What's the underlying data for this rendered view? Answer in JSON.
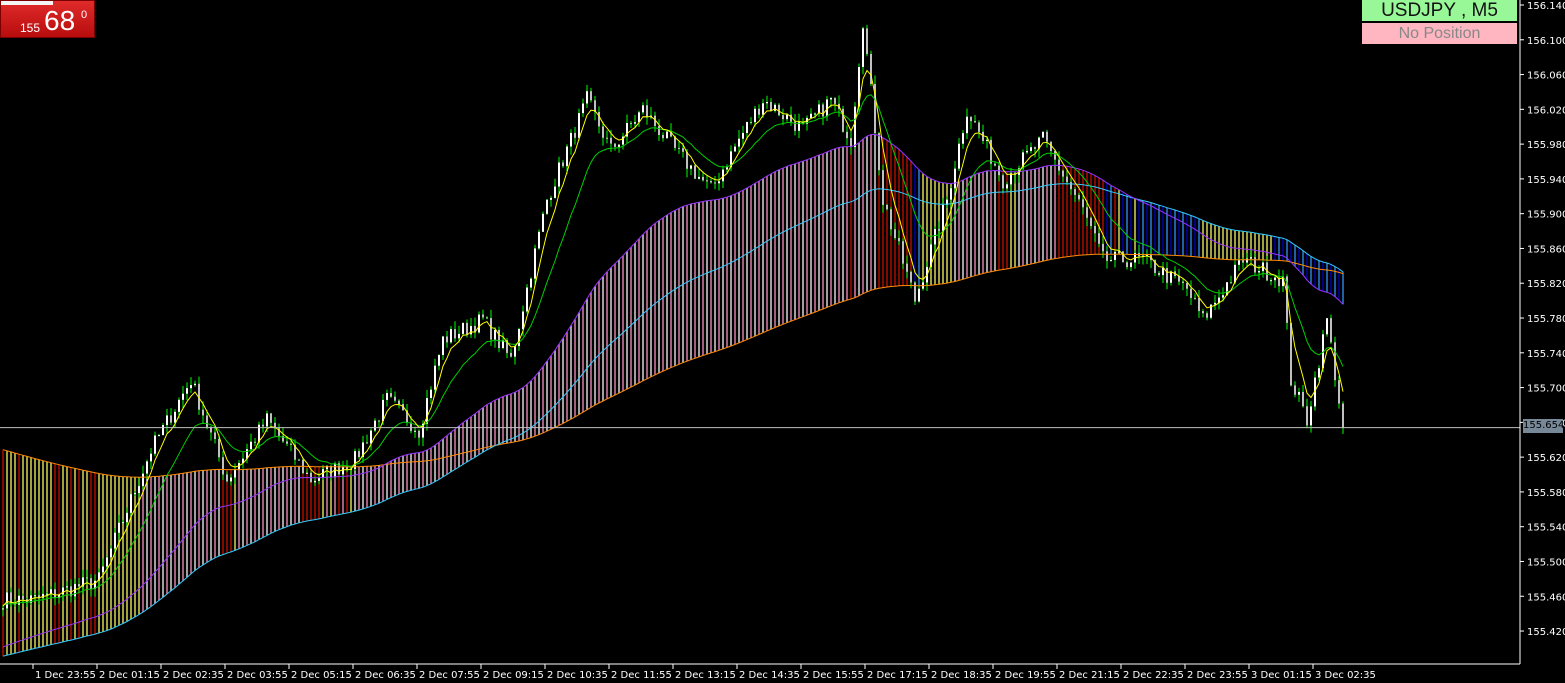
{
  "badge": {
    "big": "68",
    "small": "155",
    "sup": "0"
  },
  "symbol_label": "USDJPY , M5",
  "position_label": "No Position",
  "current_price_label": "155.654",
  "colors": {
    "bg": "#000000",
    "axis": "#ffffff",
    "wick": "#00ff00",
    "up_body": "#ffffff",
    "down_body": "#c0c0c0",
    "ema_fast": "#ffff00",
    "ema_mid": "#00cc00",
    "ema_purple": "#9933ff",
    "ema_cyan": "#33ccff",
    "ema_orange": "#ff8c00",
    "price_line": "#c0c0c0"
  },
  "chart_data": {
    "type": "candlestick",
    "title": "USDJPY , M5",
    "ylim": [
      155.38,
      156.145
    ],
    "y_ticks": [
      "156.140",
      "156.100",
      "156.060",
      "156.020",
      "155.980",
      "155.940",
      "155.900",
      "155.860",
      "155.820",
      "155.780",
      "155.740",
      "155.700",
      "155.660",
      "155.620",
      "155.580",
      "155.540",
      "155.500",
      "155.460",
      "155.420"
    ],
    "x_ticks": [
      "2:35",
      "1 Dec 23:55",
      "2 Dec 01:15",
      "2 Dec 02:35",
      "2 Dec 03:55",
      "2 Dec 05:15",
      "2 Dec 06:35",
      "2 Dec 07:55",
      "2 Dec 09:15",
      "2 Dec 10:35",
      "2 Dec 11:55",
      "2 Dec 13:15",
      "2 Dec 14:35",
      "2 Dec 15:55",
      "2 Dec 17:15",
      "2 Dec 18:35",
      "2 Dec 19:55",
      "2 Dec 21:15",
      "2 Dec 22:35",
      "2 Dec 23:55",
      "3 Dec 01:15",
      "3 Dec 02:35"
    ],
    "bars_per_tick": 16,
    "current_price": 155.654,
    "price_path": [
      [
        0,
        155.456
      ],
      [
        8,
        155.456
      ],
      [
        24,
        155.479
      ],
      [
        37,
        155.628
      ],
      [
        47,
        155.709
      ],
      [
        56,
        155.594
      ],
      [
        66,
        155.663
      ],
      [
        77,
        155.594
      ],
      [
        88,
        155.617
      ],
      [
        96,
        155.686
      ],
      [
        104,
        155.651
      ],
      [
        110,
        155.755
      ],
      [
        120,
        155.778
      ],
      [
        127,
        155.732
      ],
      [
        136,
        155.916
      ],
      [
        146,
        156.031
      ],
      [
        152,
        155.973
      ],
      [
        160,
        156.02
      ],
      [
        168,
        155.973
      ],
      [
        177,
        155.927
      ],
      [
        184,
        155.985
      ],
      [
        190,
        156.031
      ],
      [
        200,
        155.997
      ],
      [
        207,
        156.031
      ],
      [
        212,
        155.985
      ],
      [
        215,
        156.123
      ],
      [
        220,
        155.916
      ],
      [
        228,
        155.801
      ],
      [
        236,
        155.916
      ],
      [
        241,
        156.02
      ],
      [
        250,
        155.939
      ],
      [
        260,
        155.985
      ],
      [
        270,
        155.904
      ],
      [
        275,
        155.847
      ],
      [
        285,
        155.847
      ],
      [
        296,
        155.813
      ],
      [
        300,
        155.778
      ],
      [
        310,
        155.847
      ],
      [
        320,
        155.824
      ],
      [
        322,
        155.709
      ],
      [
        326,
        155.663
      ],
      [
        331,
        155.778
      ],
      [
        335,
        155.654
      ]
    ],
    "ema_seeds": {
      "fast": 155.45,
      "mid": 155.45,
      "purple": 155.4,
      "cyan": 155.39,
      "orange": 155.63
    }
  }
}
